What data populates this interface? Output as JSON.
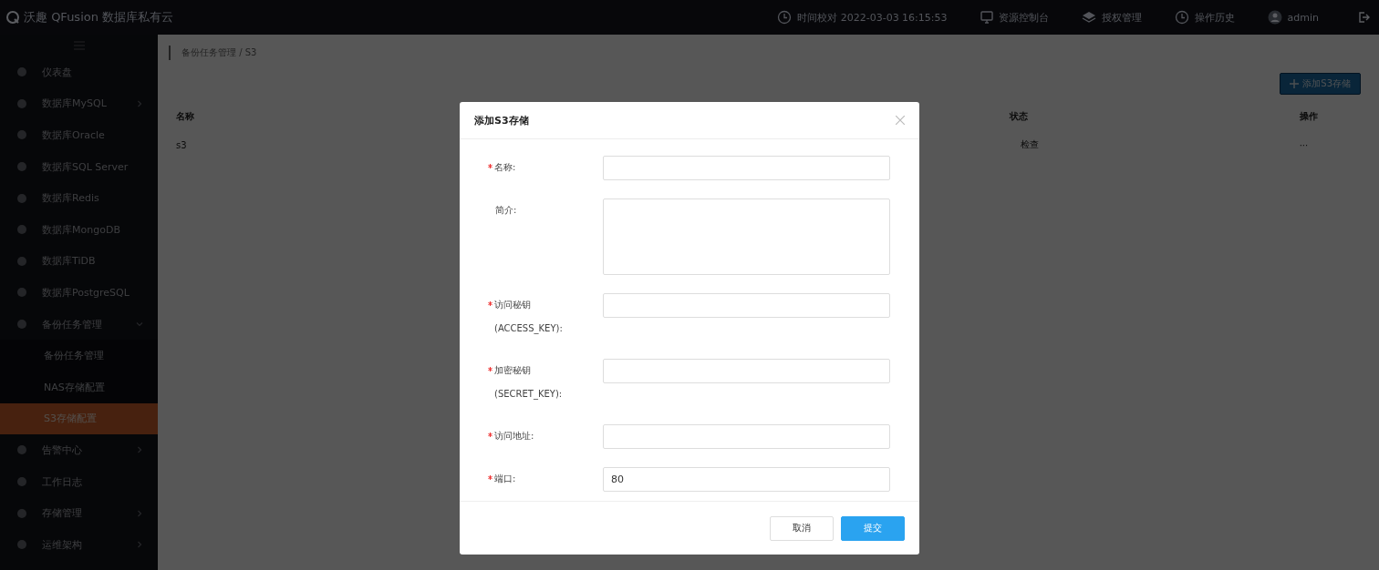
{
  "header": {
    "logo_text": "沃趣 QFusion 数据库私有云",
    "time": "时间校对 2022-03-03 16:15:53",
    "actions": [
      {
        "kind": "monitor",
        "label": "资源控制台"
      },
      {
        "kind": "layers",
        "label": "授权管理"
      },
      {
        "kind": "clock",
        "label": "操作历史"
      },
      {
        "kind": "user",
        "label": "admin"
      }
    ]
  },
  "sidebar": {
    "items": [
      {
        "label": "仪表盘",
        "selected": false,
        "has_arrow": false
      },
      {
        "label": "数据库MySQL",
        "selected": false,
        "has_arrow": true
      },
      {
        "label": "数据库Oracle",
        "selected": false,
        "has_arrow": false
      },
      {
        "label": "数据库SQL Server",
        "selected": false,
        "has_arrow": false
      },
      {
        "label": "数据库Redis",
        "selected": false,
        "has_arrow": false
      },
      {
        "label": "数据库MongoDB",
        "selected": false,
        "has_arrow": false
      },
      {
        "label": "数据库TiDB",
        "selected": false,
        "has_arrow": false
      },
      {
        "label": "数据库PostgreSQL",
        "selected": false,
        "has_arrow": false
      },
      {
        "label": "备份任务管理",
        "selected": false,
        "has_arrow": true,
        "expanded": true,
        "children": [
          {
            "label": "备份任务管理",
            "selected": false
          },
          {
            "label": "NAS存储配置",
            "selected": false
          },
          {
            "label": "S3存储配置",
            "selected": true
          }
        ]
      },
      {
        "label": "告警中心",
        "selected": false,
        "has_arrow": true
      },
      {
        "label": "工作日志",
        "selected": false,
        "has_arrow": false
      },
      {
        "label": "存储管理",
        "selected": false,
        "has_arrow": true
      },
      {
        "label": "运维架构",
        "selected": false,
        "has_arrow": true
      }
    ]
  },
  "breadcrumb": "备份任务管理 / S3",
  "add_button": "添加S3存储",
  "table": {
    "columns": [
      "名称",
      "状态",
      "操作"
    ],
    "rows": [
      [
        "s3",
        "检查",
        "···"
      ]
    ]
  },
  "dialog": {
    "title": "添加S3存储",
    "fields": [
      {
        "kind": "input",
        "label": "名称:",
        "required": true
      },
      {
        "kind": "textarea",
        "label": "简介:",
        "required": false
      },
      {
        "kind": "input",
        "label": "访问秘钥(ACCESS_KEY):",
        "required": true
      },
      {
        "kind": "input",
        "label": "加密秘钥(SECRET_KEY):",
        "required": true
      },
      {
        "kind": "input",
        "label": "访问地址:",
        "required": true
      },
      {
        "kind": "input",
        "label": "端口:",
        "required": true,
        "value": "80"
      }
    ],
    "buttons": [
      {
        "kind": "default",
        "label": "取消"
      },
      {
        "kind": "primary",
        "label": "提交"
      }
    ]
  }
}
